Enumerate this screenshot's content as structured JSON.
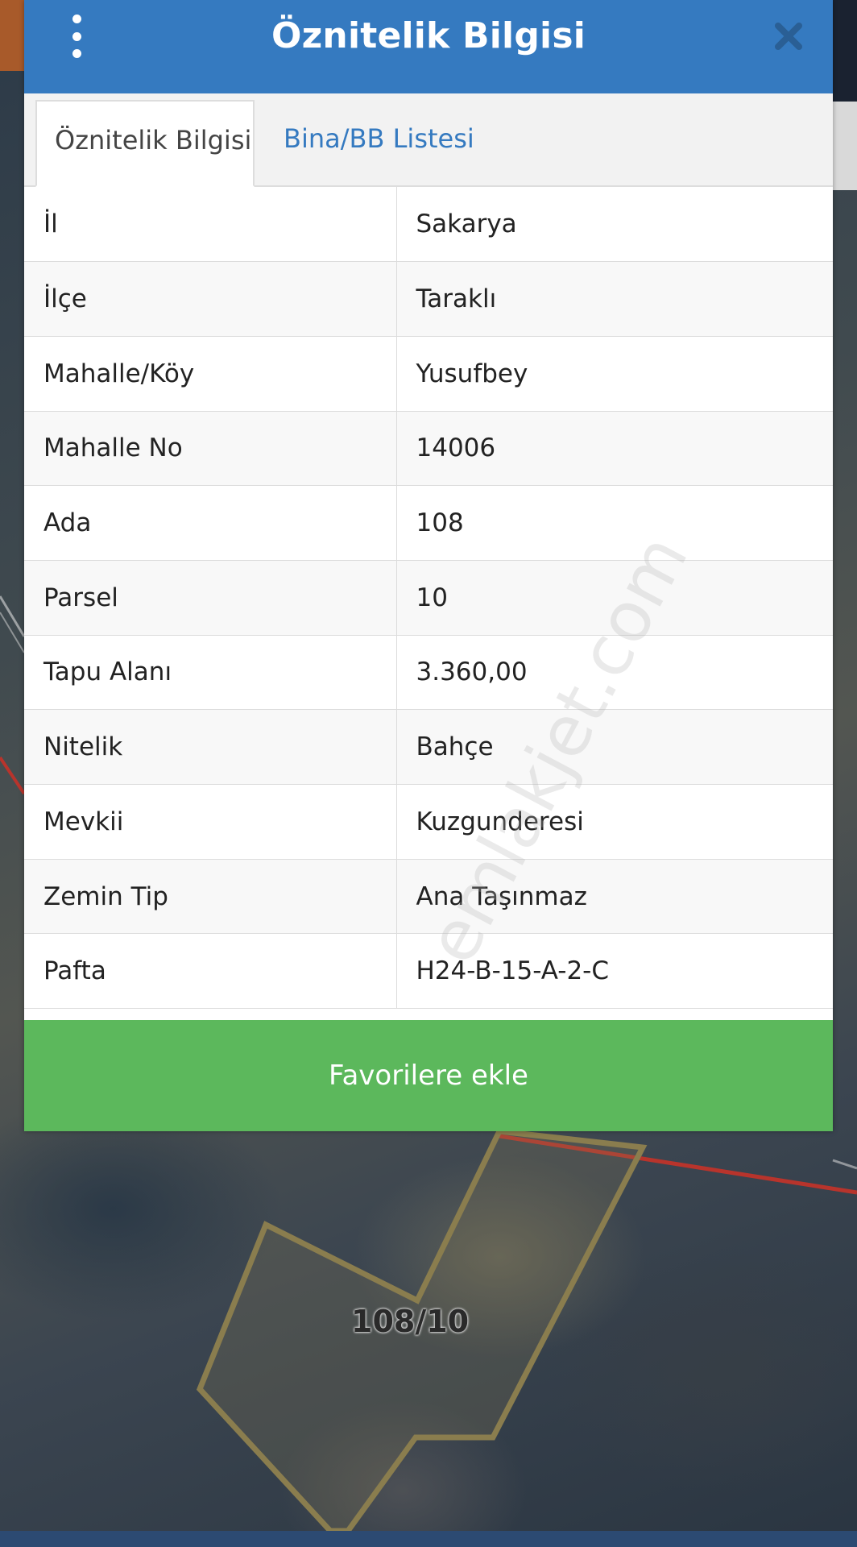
{
  "dialog": {
    "title": "Öznitelik Bilgisi",
    "menu_icon": "kebab-menu-icon",
    "close_icon": "close-icon"
  },
  "tabs": [
    {
      "label": "Öznitelik Bilgisi",
      "active": true
    },
    {
      "label": "Bina/BB Listesi",
      "active": false
    }
  ],
  "attributes": [
    {
      "key": "İl",
      "value": "Sakarya"
    },
    {
      "key": "İlçe",
      "value": "Taraklı"
    },
    {
      "key": "Mahalle/Köy",
      "value": "Yusufbey"
    },
    {
      "key": "Mahalle No",
      "value": "14006"
    },
    {
      "key": "Ada",
      "value": "108"
    },
    {
      "key": "Parsel",
      "value": "10"
    },
    {
      "key": "Tapu Alanı",
      "value": "3.360,00"
    },
    {
      "key": "Nitelik",
      "value": "Bahçe"
    },
    {
      "key": "Mevkii",
      "value": "Kuzgunderesi"
    },
    {
      "key": "Zemin Tip",
      "value": "Ana Taşınmaz"
    },
    {
      "key": "Pafta",
      "value": "H24-B-15-A-2-C"
    }
  ],
  "favorite_button": {
    "label": "Favorilere ekle"
  },
  "watermark": "emlakjet.com",
  "map": {
    "parcel_label": "108/10"
  },
  "colors": {
    "header": "#357ac0",
    "tab_link": "#357ac0",
    "favorite_button": "#5cb85c",
    "parcel_outline": "#8a7d4e",
    "boundary_line": "#b8342c"
  }
}
